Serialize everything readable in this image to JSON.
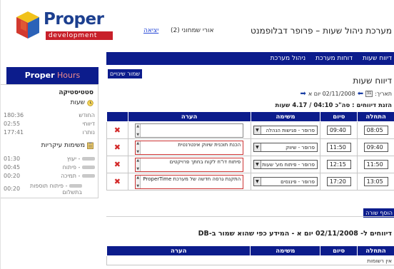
{
  "header": {
    "logo_text": "Proper",
    "logo_sub": "development",
    "exit_link": "יציאה",
    "user_name": "אורי שמחוני (2)",
    "app_title": "מערכת ניהול שעות – פרופר דבלופמנט"
  },
  "nav": [
    "דיווח שעות",
    "דוחות מערכת",
    "ניהול מערכת"
  ],
  "sidebar": {
    "brand_a": "Proper",
    "brand_b": " Hours",
    "stats_title": "סטטיסטיקה",
    "hours_section": "שעות",
    "hours_rows": [
      {
        "label": "החודש",
        "value": "180:36"
      },
      {
        "label": "דיווחי",
        "value": "02:55"
      },
      {
        "label": "נותרו",
        "value": "177:41"
      }
    ],
    "tasks_section": "משימות עיקריות",
    "task_rows": [
      {
        "label": "- יעוץ",
        "value": "01:30"
      },
      {
        "label": "- פיתוח",
        "value": "00:45"
      },
      {
        "label": "- תמיכה",
        "value": "00:20"
      },
      {
        "label": "- פיתוח תוספות בתשלום",
        "value": "00:20"
      }
    ]
  },
  "main": {
    "save_button": "שמור שינויים",
    "page_title": "דיווח שעות",
    "date_label": "תאריך:",
    "date_value": "02/11/2008 יום א",
    "summary": "הזנת דיווחים :  סה\"כ 04:10 / 4.17 שעות",
    "columns": {
      "start": "התחלה",
      "end": "סיום",
      "task": "משימה",
      "note": "הערה"
    },
    "rows": [
      {
        "start": "08:05",
        "end": "09:40",
        "task": "פרופר - פגישות הנהלה",
        "note": ""
      },
      {
        "start": "09:40",
        "end": "11:50",
        "task": "פרופר - שיווק",
        "note": "הכנת תוכנית שיווק אינטרנטית"
      },
      {
        "start": "11:50",
        "end": "12:15",
        "task": "פרופר - פיתוח מע' שעות",
        "note": "פיתוח דו\"ח לקוח בחתך פרויקטים"
      },
      {
        "start": "13:05",
        "end": "17:20",
        "task": "פרופר - פיננסים",
        "note": "התקנת גרסה חדשה של מערכת ProperTime"
      }
    ],
    "add_row_button": "הוסף שורה",
    "db_title": "דיווחים ל- 02/11/2008 יום א - המידע כפי שהוא שמור ב-DB",
    "db_columns": {
      "start": "התחלה",
      "end": "סיום",
      "task": "משימה",
      "note": "הערה"
    },
    "db_empty": "אין רשומות"
  },
  "colors": {
    "nav_bg": "#0c1c8c",
    "delete": "#d32a2a",
    "link": "#2a4bd8"
  }
}
